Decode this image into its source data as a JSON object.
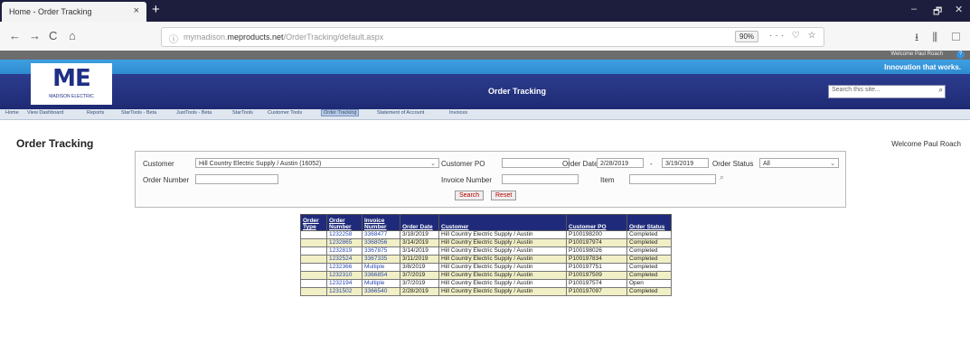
{
  "browser": {
    "tab_title": "Home - Order Tracking",
    "tab_close": "×",
    "new_tab": "+",
    "url_domain_prefix": "mymadison.",
    "url_domain": "meproducts.net",
    "url_path": "/OrderTracking/default.aspx",
    "zoom": "90%",
    "url_icons": "··· ♡ ☆",
    "toolbar_icons": "⭳ ⫼ ▢",
    "back": "←",
    "forward": "→",
    "reload": "C",
    "home": "⌂",
    "info": "ⓘ",
    "minimize": "–",
    "restore": "🗗",
    "close": "✕"
  },
  "site": {
    "welcome_top": "Welcome Paul Roach",
    "tagline": "Innovation that works.",
    "logo_text": "ME",
    "logo_sub": "MADISON ELECTRIC",
    "banner_title": "Order Tracking",
    "search_placeholder": "Search this site...",
    "search_icon": "⌕",
    "help_icon": "?"
  },
  "menu": [
    "Home",
    "View Dashboard",
    "Reports",
    "StarTools - Beta",
    "JustTools - Beta",
    "StarTools",
    "Customer Tools",
    "Order Tracking",
    "Statement of Account",
    "Invoices"
  ],
  "menu_active": "Order Tracking",
  "page": {
    "title": "Order Tracking",
    "welcome": "Welcome Paul Roach"
  },
  "filters": {
    "customer_label": "Customer",
    "customer_value": "Hill Country Electric Supply / Austin (16052)",
    "customer_po_label": "Customer PO",
    "customer_po_value": "",
    "order_date_label": "Order Date",
    "order_date_from": "2/28/2019",
    "date_separator": "-",
    "order_date_to": "3/19/2019",
    "order_status_label": "Order Status",
    "order_status_value": "All",
    "order_number_label": "Order Number",
    "order_number_value": "",
    "invoice_number_label": "Invoice Number",
    "invoice_number_value": "",
    "item_label": "Item",
    "item_value": "",
    "search_button": "Search",
    "reset_button": "Reset"
  },
  "table": {
    "headers": [
      "Order Type",
      "Order Number",
      "Invoice Number",
      "Order Date",
      "Customer",
      "Customer PO",
      "Order Status"
    ],
    "rows": [
      [
        "",
        "1232258",
        "3368477",
        "3/18/2019",
        "Hill Country Electric Supply / Austin",
        "P100198200",
        "Completed"
      ],
      [
        "",
        "1232865",
        "3368056",
        "3/14/2019",
        "Hill Country Electric Supply / Austin",
        "P100197974",
        "Completed"
      ],
      [
        "",
        "1232819",
        "3367875",
        "3/14/2019",
        "Hill Country Electric Supply / Austin",
        "P100198026",
        "Completed"
      ],
      [
        "",
        "1232524",
        "3367335",
        "3/11/2019",
        "Hill Country Electric Supply / Austin",
        "P100197834",
        "Completed"
      ],
      [
        "",
        "1232366",
        "Multiple",
        "3/8/2019",
        "Hill Country Electric Supply / Austin",
        "P100197751",
        "Completed"
      ],
      [
        "",
        "1232310",
        "3366854",
        "3/7/2019",
        "Hill Country Electric Supply / Austin",
        "P100197509",
        "Completed"
      ],
      [
        "",
        "1232194",
        "Multiple",
        "3/7/2019",
        "Hill Country Electric Supply / Austin",
        "P100197574",
        "Open"
      ],
      [
        "",
        "1231502",
        "3366540",
        "2/28/2019",
        "Hill Country Electric Supply / Austin",
        "P100197097",
        "Completed"
      ]
    ]
  },
  "colors": {
    "banner": "#1e2a73",
    "accent_blue": "#3ea0e3",
    "row_alt": "#f1efc6",
    "link": "#2a48b0"
  }
}
